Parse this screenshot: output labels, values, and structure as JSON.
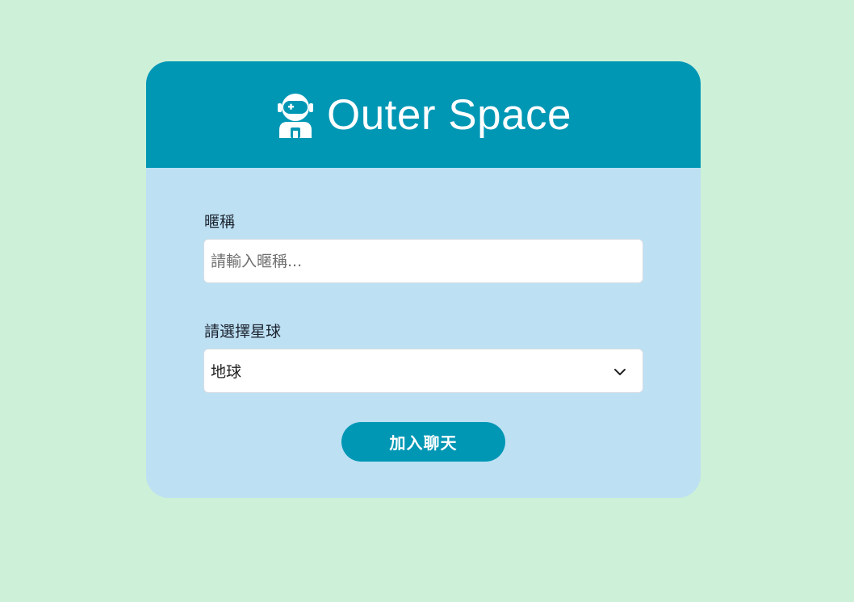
{
  "header": {
    "title": "Outer Space",
    "icon": "astronaut-icon"
  },
  "form": {
    "nickname": {
      "label": "暱稱",
      "placeholder": "請輸入暱稱...",
      "value": ""
    },
    "planet": {
      "label": "請選擇星球",
      "selected": "地球",
      "icon": "chevron-down-icon"
    },
    "submit_label": "加入聊天"
  },
  "colors": {
    "page_background": "#cdf0d8",
    "header_background": "#0097b5",
    "card_background": "#bde0f3",
    "button_background": "#0097b5",
    "button_text": "#ffffff"
  }
}
